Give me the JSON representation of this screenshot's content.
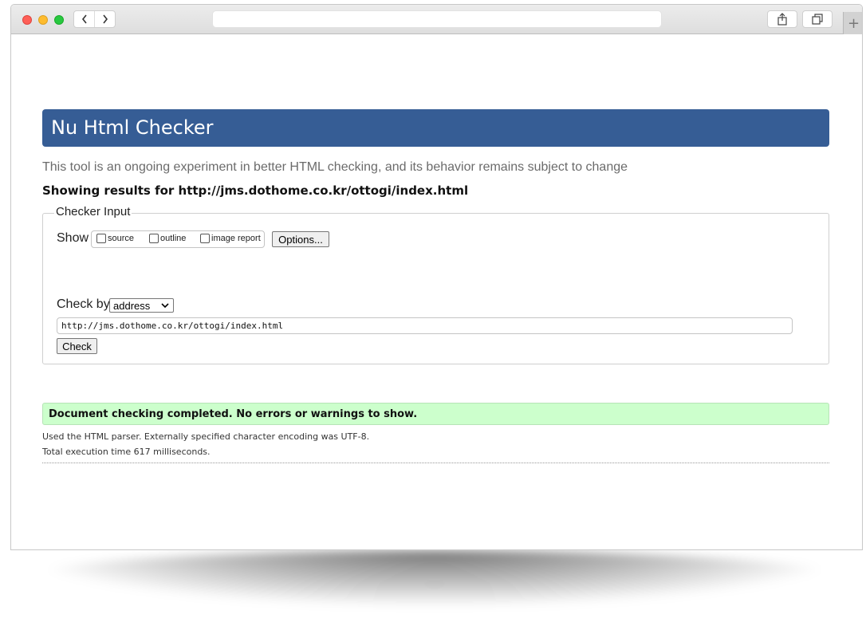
{
  "page": {
    "header_title": "Nu Html Checker",
    "tagline": "This tool is an ongoing experiment in better HTML checking, and its behavior remains subject to change",
    "showing_results": "Showing results for http://jms.dothome.co.kr/ottogi/index.html"
  },
  "checker_input": {
    "legend": "Checker Input",
    "show_label": "Show",
    "show_options": [
      {
        "label": "source",
        "checked": false
      },
      {
        "label": "outline",
        "checked": false
      },
      {
        "label": "image report",
        "checked": false
      }
    ],
    "options_button": "Options...",
    "check_by_label": "Check by",
    "check_by_selected": "address",
    "url_value": "http://jms.dothome.co.kr/ottogi/index.html",
    "check_button": "Check"
  },
  "results": {
    "success_message": "Document checking completed. No errors or warnings to show.",
    "parser_info": "Used the HTML parser. Externally specified character encoding was UTF-8.",
    "execution_time": "Total execution time 617 milliseconds."
  },
  "browser": {
    "new_tab_symbol": "+"
  },
  "colors": {
    "header_bg": "#365d95",
    "success_bg": "#ccffcc"
  }
}
